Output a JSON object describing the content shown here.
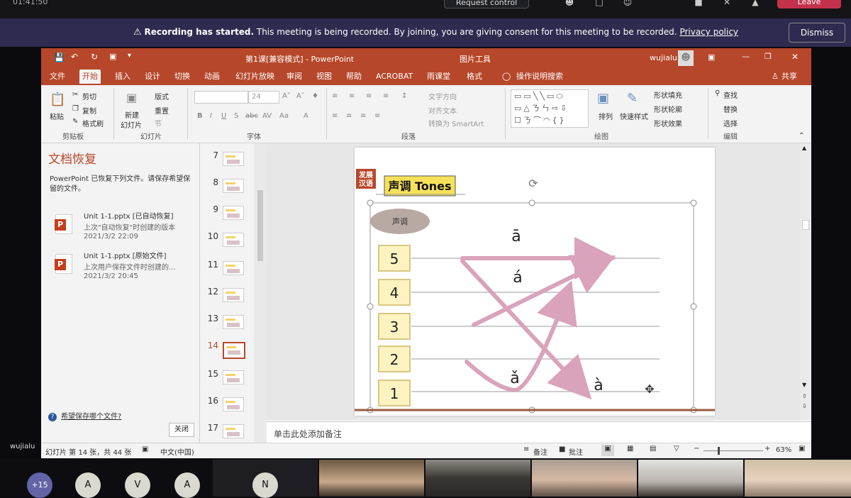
{
  "teams": {
    "timer": "01:41:50",
    "request_control": "Request control",
    "leave": "Leave",
    "recording_bold": "Recording has started.",
    "recording_text": "This meeting is being recorded. By joining, you are giving consent for this meeting to be recorded.",
    "privacy_link": "Privacy policy",
    "dismiss": "Dismiss",
    "presenter_name": "wujialu",
    "overflow_count": "+15",
    "avatars": [
      "A",
      "V",
      "A",
      "N"
    ]
  },
  "ppt": {
    "title": "第1课[兼容模式] - PowerPoint",
    "picture_tools": "图片工具",
    "user": "wujialu",
    "tabs": [
      "文件",
      "开始",
      "插入",
      "设计",
      "切换",
      "动画",
      "幻灯片放映",
      "审阅",
      "视图",
      "帮助",
      "ACROBAT",
      "雨课堂",
      "格式"
    ],
    "tell_me": "操作说明搜索",
    "share": "共享",
    "ribbon": {
      "cut": "剪切",
      "paste": "粘贴",
      "copy": "复制",
      "format_painter": "格式刷",
      "clipboard": "剪贴板",
      "new_slide": "新建",
      "new_slide2": "幻灯片",
      "layout": "版式",
      "reset": "重置",
      "section": "节",
      "slides": "幻灯片",
      "font_size": "24",
      "font": "字体",
      "text_direction": "文字方向",
      "align_text": "对齐文本",
      "smartart": "转换为 SmartArt",
      "paragraph": "段落",
      "arrange": "排列",
      "quick_styles": "快速样式",
      "shape_fill": "形状填充",
      "shape_outline": "形状轮廓",
      "shape_effects": "形状效果",
      "drawing": "绘图",
      "find": "查找",
      "replace": "替换",
      "select": "选择",
      "editing": "编辑"
    },
    "recovery": {
      "title": "文档恢复",
      "desc": "PowerPoint 已恢复下列文件。请保存希望保留的文件。",
      "files": [
        {
          "name": "Unit 1-1.pptx  [已自动恢复]",
          "sub": "上次\"自动恢复\"时创建的版本",
          "date": "2021/3/2 22:09"
        },
        {
          "name": "Unit 1-1.pptx  [原始文件]",
          "sub": "上次用户保存文件时创建的...",
          "date": "2021/3/2 20:45"
        }
      ],
      "which_file": "希望保存哪个文件?",
      "close": "关闭"
    },
    "thumbs": [
      "7",
      "8",
      "9",
      "10",
      "11",
      "12",
      "13",
      "14",
      "15",
      "16",
      "17"
    ],
    "current_slide": "14",
    "slide": {
      "badge_top": "发展",
      "badge_bottom": "汉语",
      "heading": "声调 Tones",
      "oval_label": "声调",
      "levels": [
        "5",
        "4",
        "3",
        "2",
        "1"
      ],
      "tone1": "ā",
      "tone2": "á",
      "tone3": "ǎ",
      "tone4": "à"
    },
    "notes_placeholder": "单击此处添加备注",
    "status": {
      "slide_count": "幻灯片 第 14 张，共 44 张",
      "language": "中文(中国)",
      "notes": "备注",
      "comments": "批注",
      "zoom": "63%"
    }
  }
}
